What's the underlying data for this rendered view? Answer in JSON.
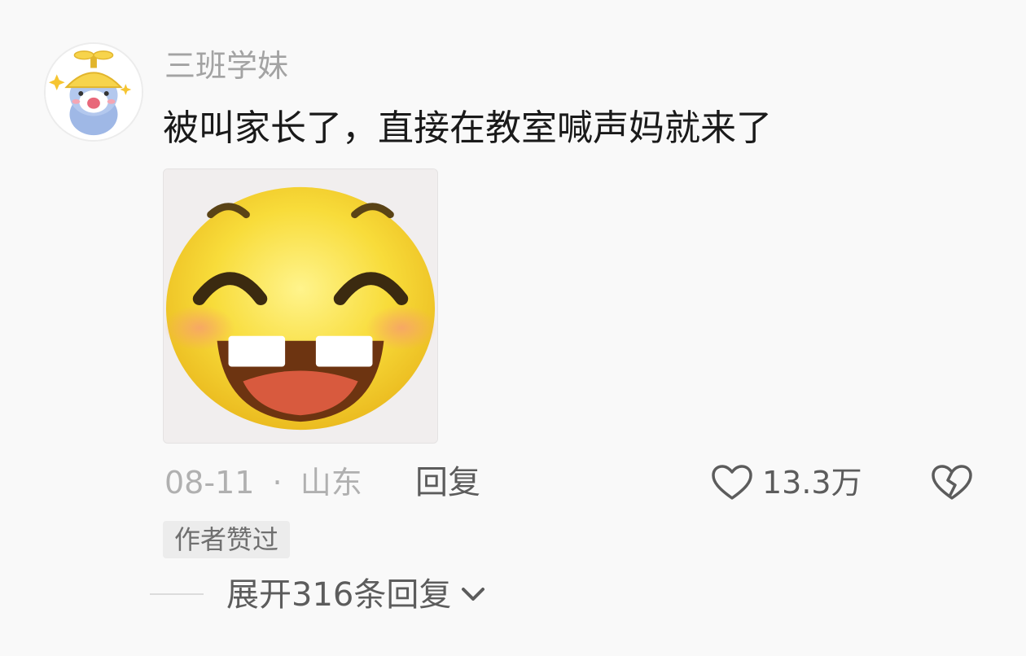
{
  "comment": {
    "username": "三班学妹",
    "text": "被叫家长了，直接在教室喊声妈就来了",
    "sticker_icon": "grinning-emoji-sticker",
    "date": "08-11",
    "separator": "·",
    "location": "山东",
    "reply_label": "回复",
    "like_count": "13.3万",
    "author_badge": "作者赞过",
    "expand_label": "展开316条回复"
  },
  "icons": {
    "avatar": "cartoon-avatar",
    "like": "heart-icon",
    "dislike": "broken-heart-icon",
    "expand": "chevron-down-icon"
  },
  "colors": {
    "background": "#f9f9f9",
    "text_primary": "#1a1a1a",
    "text_secondary": "#a3a3a3",
    "action_text": "#5c5c5c",
    "badge_bg": "#ececec"
  }
}
